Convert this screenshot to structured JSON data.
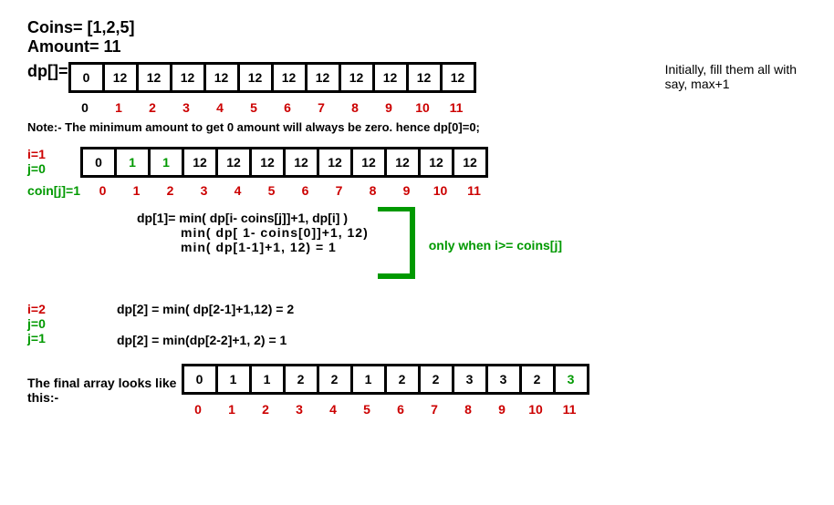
{
  "header": {
    "coins_lbl": "Coins= [1,2,5]",
    "amount_lbl": "Amount= 11",
    "dp_lbl": "dp[]=",
    "init_note": "Initially, fill them all with say, max+1",
    "note": "Note:- The minimum amount to get 0 amount will always be zero. hence dp[0]=0;"
  },
  "arr1": {
    "vals": [
      "0",
      "12",
      "12",
      "12",
      "12",
      "12",
      "12",
      "12",
      "12",
      "12",
      "12",
      "12"
    ],
    "idx": [
      "0",
      "1",
      "2",
      "3",
      "4",
      "5",
      "6",
      "7",
      "8",
      "9",
      "10",
      "11"
    ]
  },
  "step1": {
    "it_i": "i=1",
    "it_j": "j=0",
    "coin": "coin[j]=1",
    "vals": [
      "0",
      "1",
      "1",
      "12",
      "12",
      "12",
      "12",
      "12",
      "12",
      "12",
      "12",
      "12"
    ],
    "idx": [
      "0",
      "1",
      "2",
      "3",
      "4",
      "5",
      "6",
      "7",
      "8",
      "9",
      "10",
      "11"
    ],
    "hl": [
      false,
      true,
      true,
      false,
      false,
      false,
      false,
      false,
      false,
      false,
      false,
      false
    ],
    "f1": "dp[1]= min( dp[i- coins[j]]+1, dp[i] )",
    "f2": "min( dp[ 1- coins[0]]+1, 12)",
    "f3": "min( dp[1-1]+1, 12) = 1",
    "cond": "only when i>= coins[j]"
  },
  "step2": {
    "it_i": "i=2",
    "it_j0": "j=0",
    "it_j1": "j=1",
    "f1": "dp[2] = min( dp[2-1]+1,12) = 2",
    "f2": "dp[2] = min(dp[2-2]+1, 2)  =   1"
  },
  "final": {
    "lbl": "The final array looks like this:-",
    "vals": [
      "0",
      "1",
      "1",
      "2",
      "2",
      "1",
      "2",
      "2",
      "3",
      "3",
      "2",
      "3"
    ],
    "idx": [
      "0",
      "1",
      "2",
      "3",
      "4",
      "5",
      "6",
      "7",
      "8",
      "9",
      "10",
      "11"
    ],
    "hl": [
      false,
      false,
      false,
      false,
      false,
      false,
      false,
      false,
      false,
      false,
      false,
      true
    ]
  },
  "chart_data": {
    "type": "table",
    "title": "Coin Change DP array evolution",
    "coins": [
      1,
      2,
      5
    ],
    "amount": 11,
    "initial_dp": [
      0,
      12,
      12,
      12,
      12,
      12,
      12,
      12,
      12,
      12,
      12,
      12
    ],
    "after_i1_j0": [
      0,
      1,
      1,
      12,
      12,
      12,
      12,
      12,
      12,
      12,
      12,
      12
    ],
    "final_dp": [
      0,
      1,
      1,
      2,
      2,
      1,
      2,
      2,
      3,
      3,
      2,
      3
    ],
    "recurrence": "dp[i] = min(dp[i - coins[j]] + 1, dp[i]) when i >= coins[j]",
    "intermediate": [
      {
        "i": 2,
        "j": 0,
        "dp_i": 2
      },
      {
        "i": 2,
        "j": 1,
        "dp_i": 1
      }
    ]
  }
}
